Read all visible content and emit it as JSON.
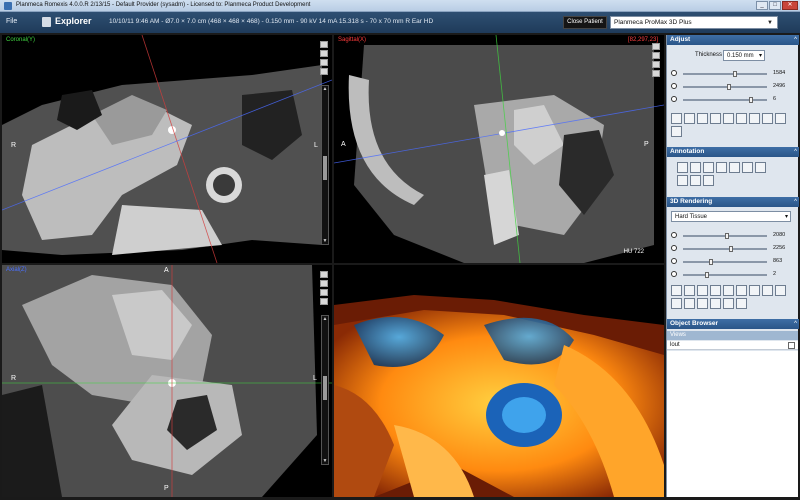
{
  "titlebar": {
    "title": "Planmeca Romexis 4.0.0.R  2/13/15 - Default Provider (sysadm) - Licensed to: Planmeca Product Development",
    "minimize": "_",
    "maximize": "□",
    "close": "✕"
  },
  "toolbar": {
    "file": "File",
    "explorer": "Explorer",
    "info": "10/10/11 9:46 AM - Ø7.0 × 7.0 cm (468 × 468 × 468) - 0.150 mm - 90 kV 14 mA 15.318 s - 70 x 70 mm R Ear HD",
    "close_patient": "Close Patient",
    "device": "Planmeca ProMax 3D Plus",
    "device_arrow": "▼"
  },
  "viewports": {
    "coronal": {
      "label": "Coronal(Y)",
      "left": "R",
      "right": "L"
    },
    "sagittal": {
      "label": "Sagittal(X)",
      "corner": "[82,297,23]",
      "left": "A",
      "right": "P",
      "hu": "HU 722"
    },
    "axial": {
      "label": "Axial(Z)",
      "top": "A",
      "bottom": "P",
      "left": "R",
      "right": "L"
    }
  },
  "panel": {
    "adjust": {
      "title": "Adjust",
      "ctl": "^",
      "thickness_label": "Thickness",
      "thickness_value": "0.150 mm",
      "sliders": [
        {
          "value": "1584",
          "pos": 0.62
        },
        {
          "value": "2496",
          "pos": 0.55
        },
        {
          "value": "6",
          "pos": 0.82
        }
      ]
    },
    "annotation": {
      "title": "Annotation",
      "ctl": "^"
    },
    "rendering": {
      "title": "3D Rendering",
      "ctl": "^",
      "preset": "Hard Tissue",
      "sliders": [
        {
          "value": "2080",
          "pos": 0.52
        },
        {
          "value": "2256",
          "pos": 0.58
        },
        {
          "value": "863",
          "pos": 0.33
        },
        {
          "value": "2",
          "pos": 0.28
        }
      ]
    },
    "object_browser": {
      "title": "Object Browser",
      "ctl": "^",
      "views_label": "Views",
      "item": "lout"
    }
  },
  "colors": {
    "label_green": "#3fd43f",
    "label_red": "#ff3b3b",
    "label_blue": "#4a70ff",
    "header_blue": "#2a5588",
    "bone_orange": "#ff9a20",
    "tissue_blue": "#2a8ad6"
  }
}
